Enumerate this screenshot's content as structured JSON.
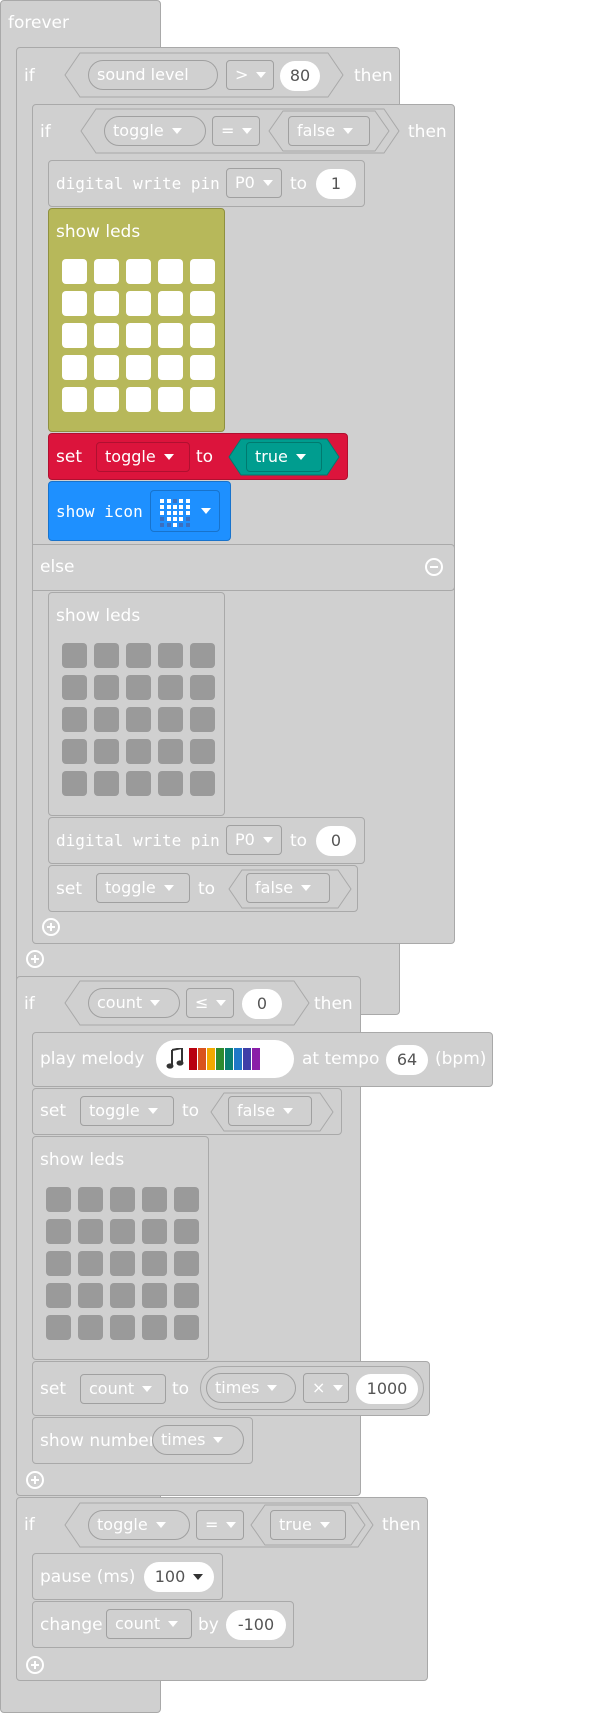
{
  "forever": {
    "label": "forever"
  },
  "if1": {
    "if_label": "if",
    "then_label": "then",
    "var": "sound level",
    "op": ">",
    "value": "80"
  },
  "if2": {
    "if_label": "if",
    "then_label": "then",
    "var": "toggle",
    "op": "=",
    "value": "false",
    "else_label": "else"
  },
  "digital_write_1": {
    "label": "digital write pin",
    "pin": "P0",
    "to": "to",
    "value": "1"
  },
  "show_leds_label": "show leds",
  "set_toggle_true": {
    "set": "set",
    "var": "toggle",
    "to": "to",
    "value": "true"
  },
  "show_icon": {
    "label": "show icon",
    "icon": "heart-icon"
  },
  "digital_write_2": {
    "label": "digital write pin",
    "pin": "P0",
    "to": "to",
    "value": "0"
  },
  "set_toggle_false_1": {
    "set": "set",
    "var": "toggle",
    "to": "to",
    "value": "false"
  },
  "if3": {
    "if_label": "if",
    "then_label": "then",
    "var": "count",
    "op": "≤",
    "value": "0"
  },
  "play_melody": {
    "label": "play melody",
    "at_tempo": "at tempo",
    "tempo": "64",
    "unit": "(bpm)"
  },
  "set_toggle_false_2": {
    "set": "set",
    "var": "toggle",
    "to": "to",
    "value": "false"
  },
  "set_count": {
    "set": "set",
    "var": "count",
    "to": "to",
    "left": "times",
    "op": "×",
    "right": "1000"
  },
  "show_number": {
    "label": "show number",
    "value": "times"
  },
  "if4": {
    "if_label": "if",
    "then_label": "then",
    "var": "toggle",
    "op": "=",
    "value": "true"
  },
  "pause": {
    "label": "pause (ms)",
    "value": "100"
  },
  "change_count": {
    "label": "change",
    "var": "count",
    "by": "by",
    "value": "-100"
  },
  "colors": {
    "block_gray": "#d0d0d0",
    "set_red": "#dc143c",
    "logic_teal": "#009d8f",
    "basic_blue": "#1e90ff",
    "leds_yellow": "#b7b85a"
  }
}
